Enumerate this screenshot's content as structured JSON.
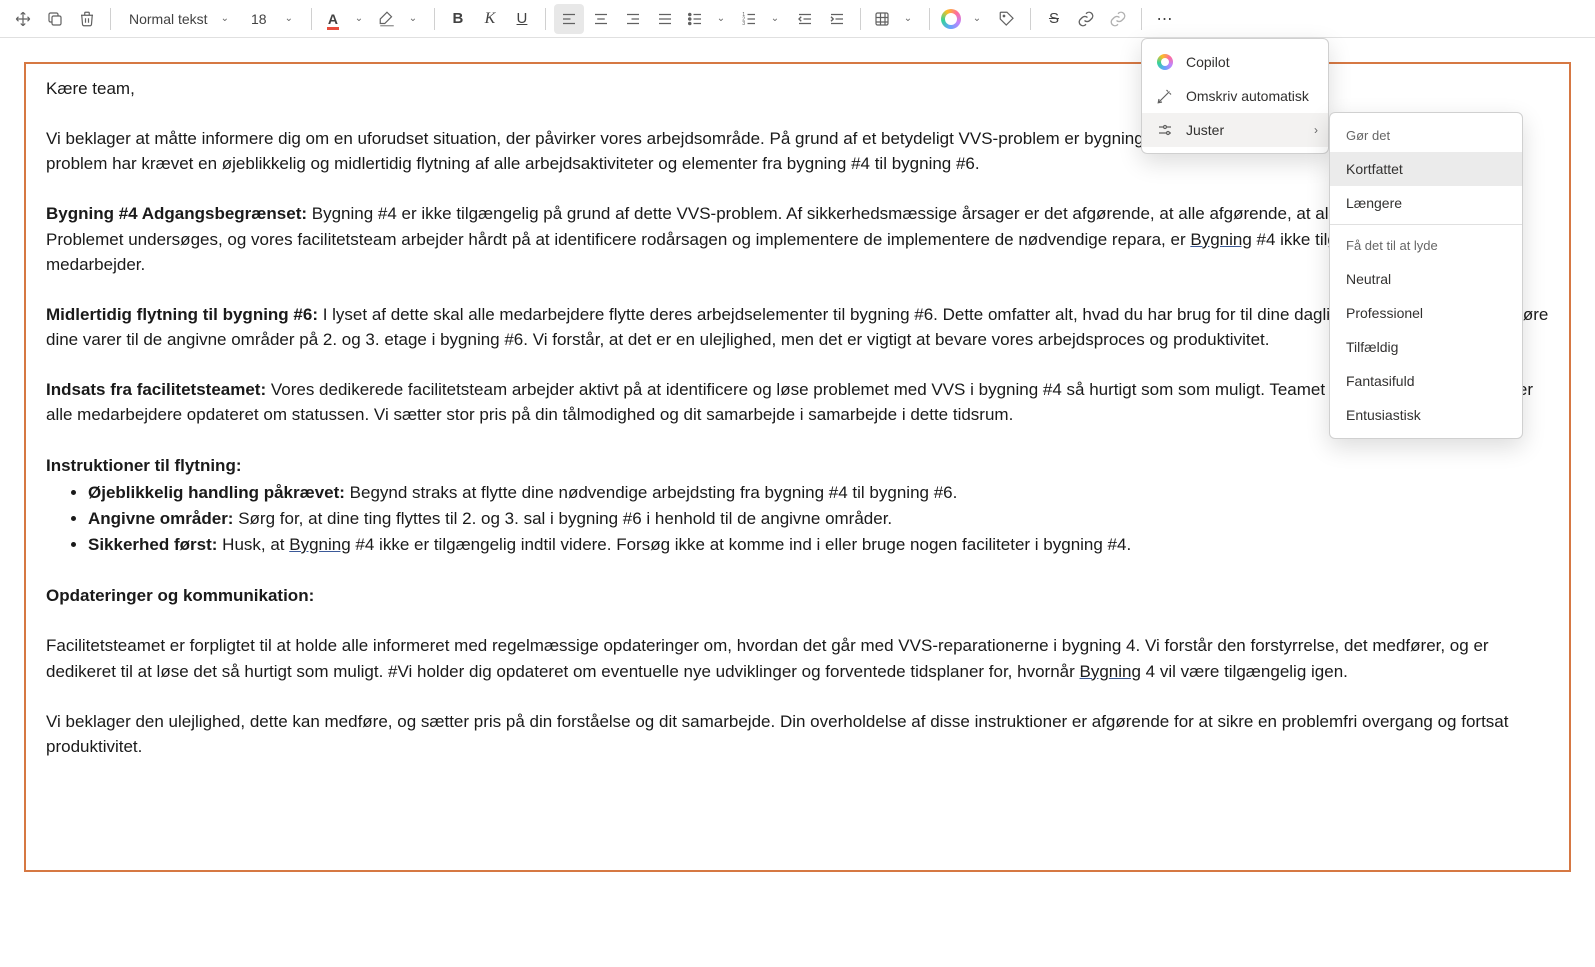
{
  "toolbar": {
    "styleName": "Normal tekst",
    "fontSize": "18"
  },
  "menus": {
    "level1": {
      "copilot": "Copilot",
      "rewrite": "Omskriv automatisk",
      "adjust": "Juster"
    },
    "level2": {
      "header": "Gør det",
      "concise": "Kortfattet",
      "longer": "Længere",
      "soundLike": "Få det til at lyde",
      "neutral": "Neutral",
      "professional": "Professionel",
      "random": "Tilfældig",
      "imaginative": "Fantasifuld",
      "enthusiastic": "Entusiastisk"
    }
  },
  "document": {
    "greeting": "Kære team,",
    "intro": "Vi beklager at måtte informere dig om en uforudset situation, der påvirker vores arbejdsområde. På grund af et betydeligt VVS-problem er bygning #4 ikke tilgængelig i øjeblikket. Dette uforudsete problem har krævet en øjeblikkelig og midlertidig flytning af alle arbejdsaktiviteter og elementer fra bygning #4 til bygning #6.",
    "s1_title": "Bygning #4 Adgangsbegrænset:",
    "s1_body_a": " Bygning #4 er ikke tilgængelig på grund af dette VVS-problem. Af sikkerhedsmæssige årsager er det afgørende, at alle afgørende, at alle overholder denne Problemet undersøges, og vores facilitetsteam arbejder hårdt på at identificere rodårsagen og implementere de implementere de nødvendige repara, er ",
    "s1_link": "Bygning",
    "s1_body_b": " #4 ikke tilgængelig for nogen medarbejder.",
    "s2_title": "Midlertidig flytning til bygning #6:",
    "s2_body": " I lyset af dette skal alle medarbejdere flytte deres arbejdselementer til bygning #6. Dette omfatter alt, hvad du har brug for til dine daglige opgaver. Du skal overføre dine varer til de angivne områder på 2. og 3. etage i bygning #6. Vi forstår, at det er en ulejlighed, men det er vigtigt at bevare vores arbejdsproces og produktivitet.",
    "s3_title": "Indsats fra facilitetsteamet:",
    "s3_body": " Vores dedikerede facilitetsteam arbejder aktivt på at identificere og løse problemet med VVS i bygning #4 så hurtigt som som muligt. Teamet leverer opdaterin og holder alle medarbejdere opdateret om statussen. Vi sætter stor pris på din tålmodighed og dit samarbejde i samarbejde i dette tidsrum.",
    "s4_title": "Instruktioner til flytning:",
    "li1_b": "Øjeblikkelig handling påkrævet:",
    "li1_t": " Begynd straks at flytte dine nødvendige arbejdsting fra bygning #4 til bygning #6.",
    "li2_b": "Angivne områder:",
    "li2_t": " Sørg for, at dine ting flyttes til 2. og 3. sal i bygning #6 i henhold til de angivne områder.",
    "li3_b": "Sikkerhed først:",
    "li3_t_a": " Husk, at ",
    "li3_link": "Bygning",
    "li3_t_b": " #4 ikke er tilgængelig indtil videre. Forsøg ikke at komme ind i eller bruge nogen faciliteter i bygning #4.",
    "s5_title": "Opdateringer og kommunikation:",
    "s5_body_a": "Facilitetsteamet er forpligtet til at holde alle informeret med regelmæssige opdateringer om, hvordan det går med VVS-reparationerne i bygning 4. Vi forstår den forstyrrelse, det medfører, og er dedikeret til at løse det så hurtigt som muligt. #Vi holder dig opdateret om eventuelle nye udviklinger og forventede tidsplaner for, hvornår ",
    "s5_link": "Bygning",
    "s5_body_b": " 4 vil være tilgængelig igen.",
    "closing": "Vi beklager den ulejlighed, dette kan medføre, og sætter pris på din forståelse og dit samarbejde. Din overholdelse af disse instruktioner er afgørende for at sikre en problemfri overgang og fortsat produktivitet."
  }
}
